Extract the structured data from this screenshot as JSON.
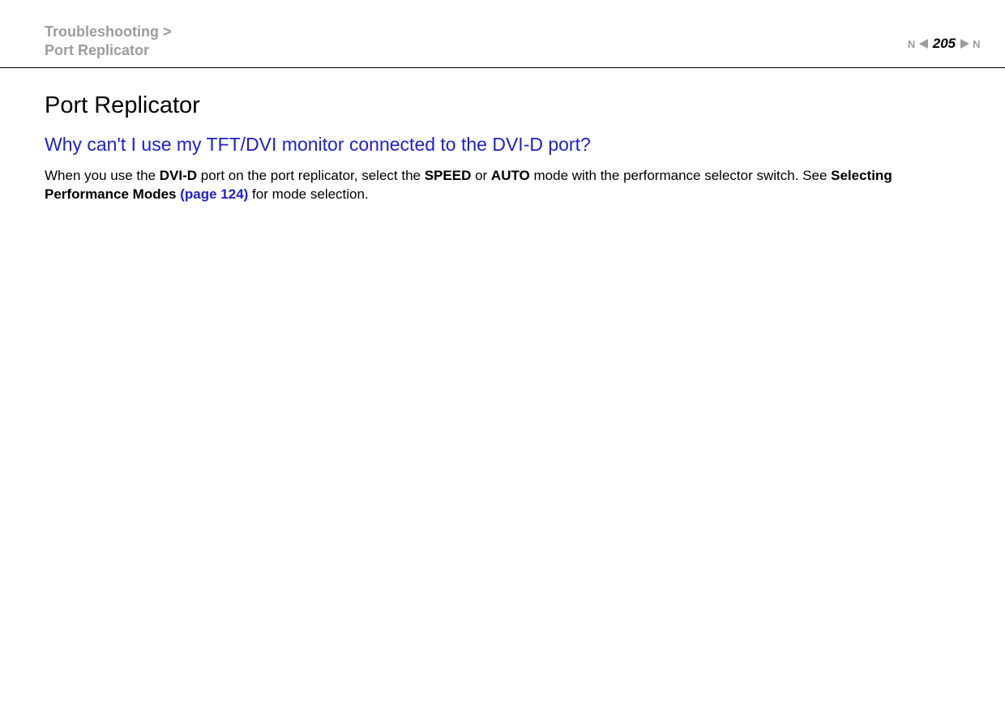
{
  "header": {
    "breadcrumb_section": "Troubleshooting",
    "breadcrumb_sep": " > ",
    "breadcrumb_page": "Port Replicator",
    "page_number": "205",
    "nav_n": "N"
  },
  "content": {
    "section_title": "Port Replicator",
    "question": "Why can't I use my TFT/DVI monitor connected to the DVI-D port?",
    "body": {
      "t1": "When you use the ",
      "b1": "DVI-D",
      "t2": " port on the port replicator, select the ",
      "b2": "SPEED",
      "t3": " or ",
      "b3": "AUTO",
      "t4": " mode with the performance selector switch. See ",
      "b4": "Selecting Performance Modes",
      "t5": " ",
      "link": "(page 124)",
      "t6": " for mode selection."
    }
  }
}
